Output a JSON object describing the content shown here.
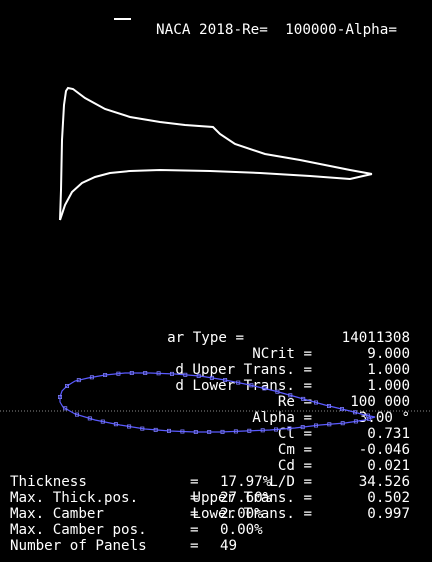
{
  "legend": {
    "label": "NACA 2018-Re=  100000-Alpha="
  },
  "params": [
    {
      "label": "ar Type =",
      "value": "14011308"
    },
    {
      "label": "NCrit =",
      "value": "9.000"
    },
    {
      "label": "d Upper Trans. =",
      "value": "1.000"
    },
    {
      "label": "d Lower Trans. =",
      "value": "1.000"
    },
    {
      "label": "Re =",
      "value": "100 000"
    },
    {
      "label": "Alpha =",
      "value": "3.00 °"
    },
    {
      "label": "Cl =",
      "value": "0.731"
    },
    {
      "label": "Cm =",
      "value": "-0.046"
    },
    {
      "label": "Cd =",
      "value": "0.021"
    },
    {
      "label": "L/D =",
      "value": "34.526"
    },
    {
      "label": "Upper Trans. =",
      "value": "0.502"
    },
    {
      "label": "Lower Trans. =",
      "value": "0.997"
    }
  ],
  "geometry": [
    {
      "label": "Thickness",
      "eq": "=",
      "value": "17.97%"
    },
    {
      "label": "Max. Thick.pos.",
      "eq": "=",
      "value": "27.60%"
    },
    {
      "label": "Max. Camber",
      "eq": "=",
      "value": "2.00%"
    },
    {
      "label": "Max. Camber pos.",
      "eq": "=",
      "value": "0.00%"
    },
    {
      "label": "Number of Panels",
      "eq": "=",
      "value": "49"
    }
  ],
  "colors": {
    "background": "#000000",
    "text": "#ffffff",
    "curve": "#ffffff",
    "foil_outline": "#5a5aff",
    "dotted_line": "#8a8a8a"
  }
}
